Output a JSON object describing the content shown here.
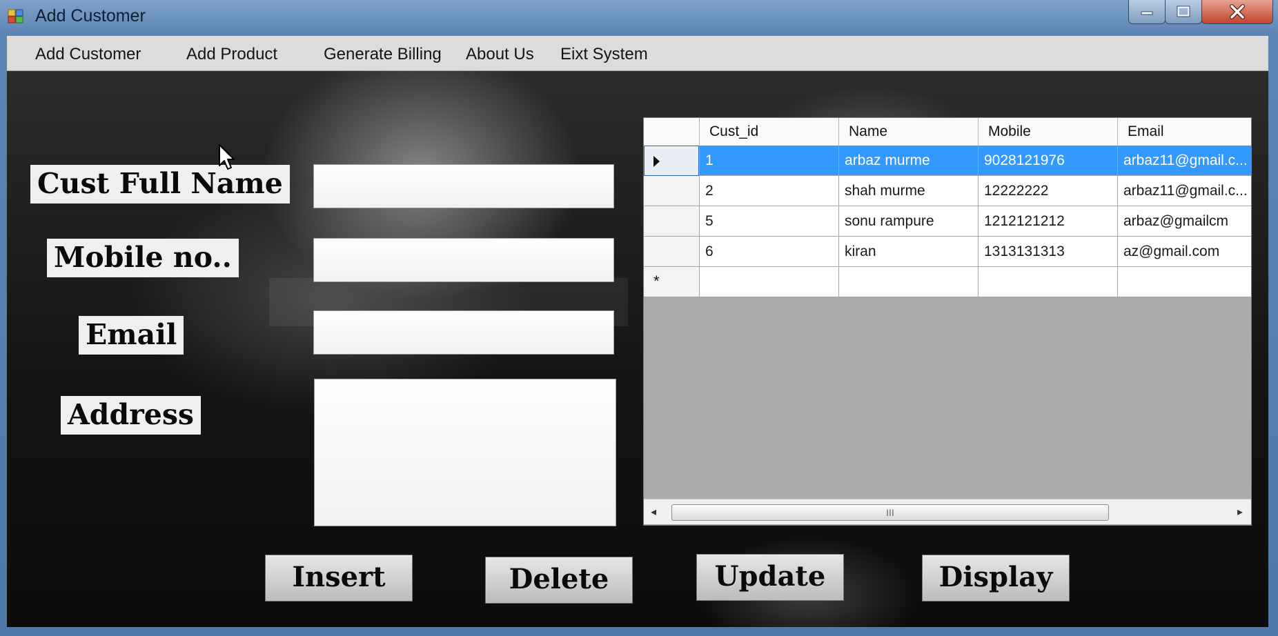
{
  "window": {
    "title": "Add Customer",
    "accent": "#5c84b4",
    "buttons": [
      "minimize-icon",
      "maximize-icon",
      "close-icon"
    ]
  },
  "menu": {
    "items": [
      {
        "label": "Add Customer"
      },
      {
        "label": "Add Product"
      },
      {
        "label": "Generate Billing"
      },
      {
        "label": "About Us"
      },
      {
        "label": "Eixt System"
      }
    ]
  },
  "form": {
    "labels": {
      "full_name": "Cust Full Name",
      "mobile": "Mobile no..",
      "email": "Email",
      "address": "Address"
    },
    "values": {
      "full_name": "",
      "mobile": "",
      "email": "",
      "address": ""
    }
  },
  "grid": {
    "columns": [
      "Cust_id",
      "Name",
      "Mobile",
      "Email"
    ],
    "rows": [
      {
        "cust_id": "1",
        "name": "arbaz murme",
        "mobile": "9028121976",
        "email": "arbaz11@gmail.c..."
      },
      {
        "cust_id": "2",
        "name": "shah murme",
        "mobile": "12222222",
        "email": "arbaz11@gmail.c..."
      },
      {
        "cust_id": "5",
        "name": "sonu rampure",
        "mobile": "1212121212",
        "email": "arbaz@gmailcm"
      },
      {
        "cust_id": "6",
        "name": "kiran",
        "mobile": "1313131313",
        "email": "az@gmail.com"
      }
    ],
    "selected_row": 0,
    "selection_color": "#3399ff",
    "new_row_marker": "*",
    "scrollbar_grip": "III"
  },
  "buttons": {
    "insert": "Insert",
    "delete": "Delete",
    "update": "Update",
    "display": "Display"
  }
}
